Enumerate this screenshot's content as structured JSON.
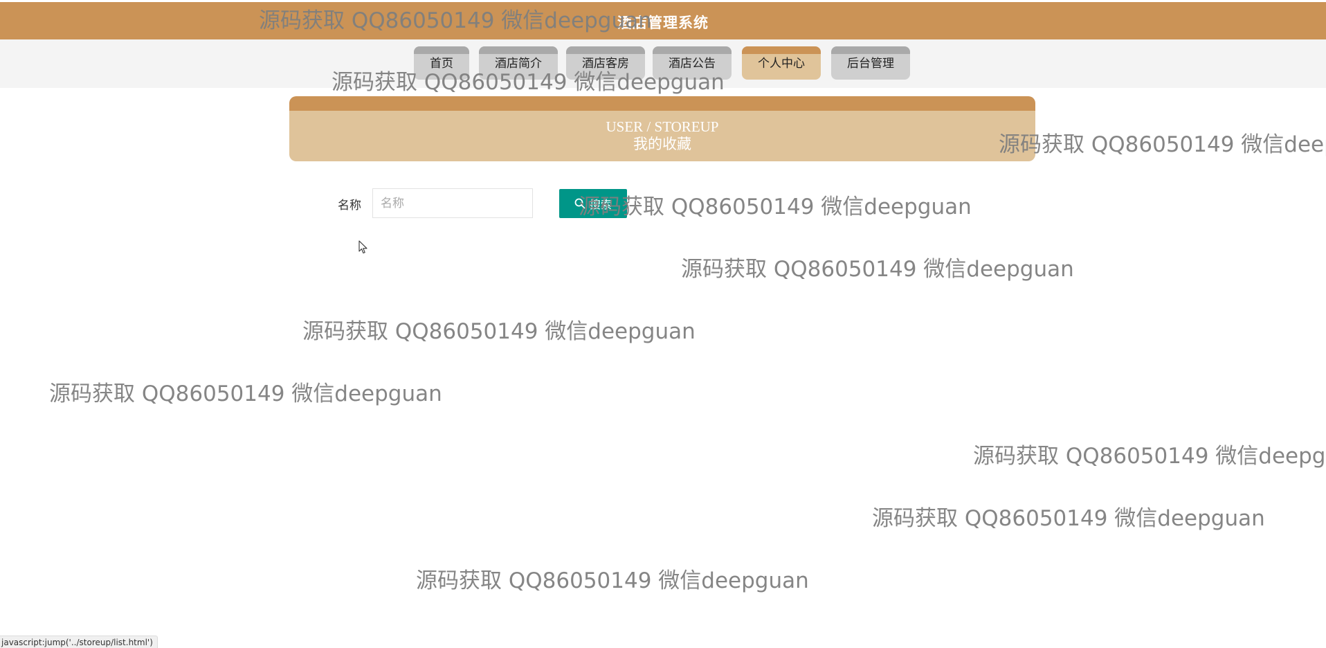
{
  "header": {
    "title": "酒店管理系统"
  },
  "nav": {
    "items": [
      {
        "label": "首页"
      },
      {
        "label": "酒店简介"
      },
      {
        "label": "酒店客房"
      },
      {
        "label": "酒店公告"
      },
      {
        "label": "个人中心"
      },
      {
        "label": "后台管理"
      }
    ],
    "active": "个人中心"
  },
  "banner": {
    "title_en": "USER / STOREUP",
    "title_cn": "我的收藏"
  },
  "search": {
    "label": "名称",
    "placeholder": "名称",
    "value": "",
    "button_label": "搜索"
  },
  "watermark": {
    "text": "源码获取 QQ86050149 微信deepguan"
  },
  "status_bar": {
    "text": "javascript:jump('../storeup/list.html')"
  },
  "colors": {
    "header": "#cb9356",
    "banner": "#dfc39a",
    "search_button": "#009688",
    "nav_inactive": "#cfcfcf",
    "nav_active": "#e0c49a"
  },
  "icons": {
    "search_button": "search-icon",
    "cursor": "mouse-pointer-icon"
  }
}
